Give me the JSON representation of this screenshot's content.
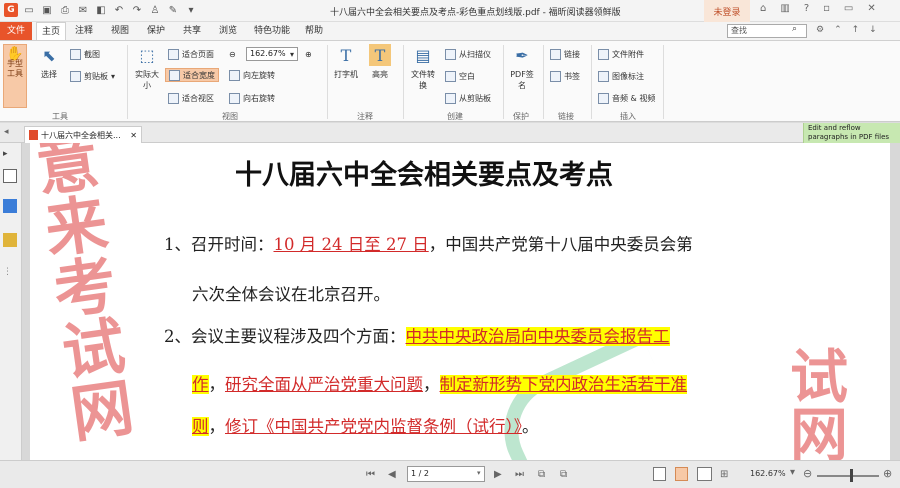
{
  "titlebar": {
    "title": "十八届六中全会相关要点及考点-彩色重点划线版.pdf - 福昕阅读器领鲜版",
    "login": "未登录"
  },
  "menu": {
    "file": "文件",
    "tabs": [
      "主页",
      "注释",
      "视图",
      "保护",
      "共享",
      "浏览",
      "特色功能",
      "帮助"
    ],
    "search_placeholder": "查找"
  },
  "ribbon": {
    "hand_tool": "手型工具",
    "select": "选择",
    "screenshot": "截图",
    "clipboard": "剪贴板",
    "actual_size": "实际大小",
    "fit_page": "适合页面",
    "fit_width": "适合宽度",
    "fit_view": "适合视区",
    "zoom": "162.67%",
    "rotate_left": "向左旋转",
    "rotate_right": "向右旋转",
    "typewriter": "打字机",
    "highlight": "高亮",
    "file_convert": "文件转换",
    "from_scanner": "从扫描仪",
    "blank": "空白",
    "from_clipboard": "从剪贴板",
    "pdf_sign": "PDF签名",
    "link": "链接",
    "bookmark": "书签",
    "file_attach": "文件附件",
    "image_annot": "图像标注",
    "audio_video": "音频 & 视频",
    "groups": [
      "工具",
      "视图",
      "注释",
      "创建",
      "保护",
      "链接",
      "插入"
    ]
  },
  "doctab": {
    "label": "十八届六中全会相关...",
    "reflow": "Edit and reflow paragraphs in PDF files"
  },
  "document": {
    "title": "十八届六中全会相关要点及考点",
    "p1_num": "1、",
    "p1_pre": "召开时间：",
    "p1_date": "10 月 24 日至 27 日",
    "p1_post": "，中国共产党第十八届中央委员会第",
    "p1_line2": "六次全体会议在北京召开。",
    "p2_num": "2、",
    "p2_pre": "会议主要议程涉及四个方面：",
    "p2_hl1": "中共中央政治局向中央委员会报告工",
    "p2_hl1b": "作",
    "p2_c1": "，",
    "p2_u1": "研究全面从严治党重大问题",
    "p2_c2": "，",
    "p2_hl2": "制定新形势下党内政治生活若干准",
    "p2_hl2b": "则",
    "p2_c3": "，",
    "p2_u2": "修订《中国共产党党内监督条例（试行）》",
    "p2_end": "。",
    "watermark_left": "意来考试网",
    "watermark_right": "试网"
  },
  "status": {
    "page": "1 / 2",
    "zoom": "162.67%"
  }
}
